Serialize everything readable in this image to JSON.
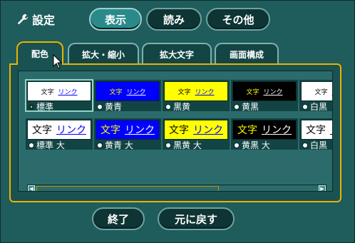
{
  "header": {
    "title": "設定",
    "buttons": [
      "表示",
      "読み",
      "その他"
    ]
  },
  "tabs": [
    "配色",
    "拡大・縮小",
    "拡大文字",
    "画面構成"
  ],
  "swatches": {
    "sample_text": "文字",
    "sample_link": "リンク",
    "row1": [
      {
        "label": "標準",
        "bg": "#ffffff",
        "fg": "#000000",
        "link": "#0000ff",
        "selected": true
      },
      {
        "label": "黄青",
        "bg": "#0000ff",
        "fg": "#ffff00",
        "link": "#ffffff",
        "selected": false
      },
      {
        "label": "黒黄",
        "bg": "#ffff00",
        "fg": "#000000",
        "link": "#0000ff",
        "selected": false
      },
      {
        "label": "黄黒",
        "bg": "#000000",
        "fg": "#ffff00",
        "link": "#ffffff",
        "selected": false
      },
      {
        "label": "白黒",
        "bg": "#ffffff",
        "fg": "#000000",
        "link": "#000000",
        "selected": false
      }
    ],
    "row2": [
      {
        "label": "標準 大",
        "bg": "#ffffff",
        "fg": "#000000",
        "link": "#0000ff"
      },
      {
        "label": "黄青 大",
        "bg": "#0000ff",
        "fg": "#ffff00",
        "link": "#ffffff"
      },
      {
        "label": "黒黄 大",
        "bg": "#ffff00",
        "fg": "#000000",
        "link": "#0000ff"
      },
      {
        "label": "黄黒 大",
        "bg": "#000000",
        "fg": "#ffff00",
        "link": "#ffffff"
      },
      {
        "label": "白黒",
        "bg": "#ffffff",
        "fg": "#000000",
        "link": "#000000"
      }
    ]
  },
  "footer": {
    "end_label": "終了",
    "reset_label": "元に戻す"
  },
  "colors": {
    "background": "#1f5c5c",
    "accent": "#e8b400"
  }
}
